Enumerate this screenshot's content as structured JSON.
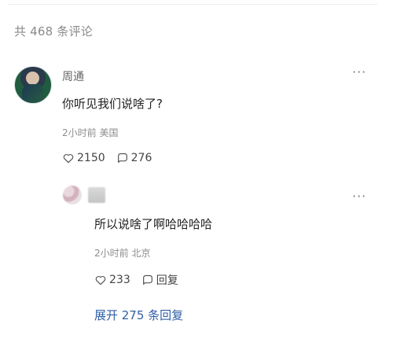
{
  "header": {
    "comment_count_text": "共 468 条评论"
  },
  "comments": [
    {
      "username": "周通",
      "content": "你听见我们说啥了?",
      "time": "2小时前",
      "location": "美国",
      "like_count": "2150",
      "reply_count": "276",
      "more_label": "···"
    }
  ],
  "replies": [
    {
      "username_visible": "",
      "content": "所以说啥了啊哈哈哈哈",
      "time": "2小时前",
      "location": "北京",
      "like_count": "233",
      "reply_label": "回复",
      "more_label": "···"
    }
  ],
  "expand_replies": {
    "label": "展开 275 条回复"
  },
  "icons": {
    "heart": "heart-icon",
    "comment": "comment-icon",
    "more": "more-icon"
  }
}
